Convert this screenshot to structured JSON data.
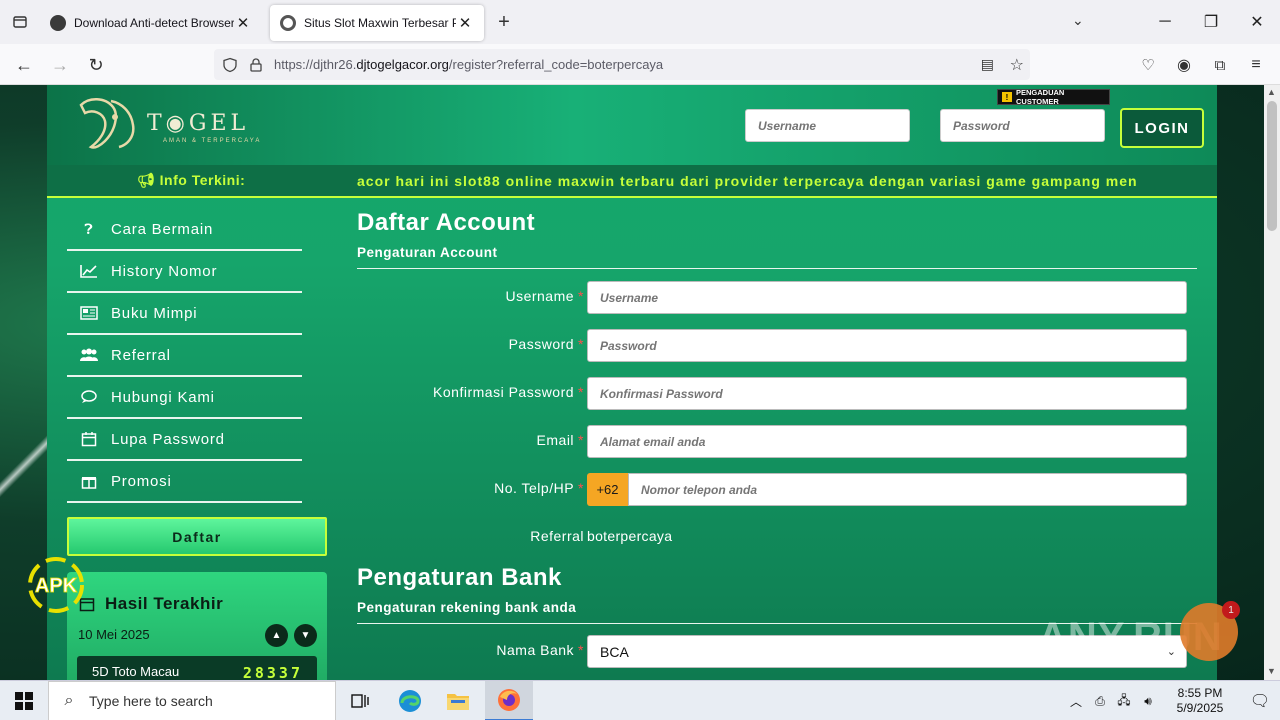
{
  "browser": {
    "tabs": [
      {
        "title": "Download Anti-detect Browser",
        "active": false
      },
      {
        "title": "Situs Slot Maxwin Terbesar Palin",
        "active": true
      }
    ],
    "url_prefix": "https://djthr26.",
    "url_domain": "djtogelgacor.org",
    "url_path": "/register?referral_code=boterpercaya"
  },
  "site": {
    "logo_text": "T◉GEL",
    "logo_tagline": "AMAN & TERPERCAYA",
    "header": {
      "username_placeholder": "Username",
      "password_placeholder": "Password",
      "login_label": "LOGIN",
      "complaint_label": "PENGADUAN CUSTOMER"
    },
    "ticker": {
      "label": "Info Terkini:",
      "message": "acor hari ini slot88 online maxwin terbaru dari provider terpercaya dengan variasi game gampang men"
    },
    "sidebar": {
      "items": [
        {
          "label": "Cara Bermain",
          "icon": "question-circle-icon"
        },
        {
          "label": "History Nomor",
          "icon": "line-chart-icon"
        },
        {
          "label": "Buku Mimpi",
          "icon": "newspaper-icon"
        },
        {
          "label": "Referral",
          "icon": "users-icon"
        },
        {
          "label": "Hubungi Kami",
          "icon": "chat-icon"
        },
        {
          "label": "Lupa Password",
          "icon": "calendar-icon"
        },
        {
          "label": "Promosi",
          "icon": "gift-icon"
        }
      ],
      "daftar_label": "Daftar"
    },
    "hasil": {
      "title": "Hasil Terakhir",
      "date": "10 Mei 2025",
      "rows": [
        {
          "name": "5D Toto Macau",
          "value": "28337"
        }
      ]
    },
    "form": {
      "title": "Daftar Account",
      "subtitle": "Pengaturan Account",
      "fields": {
        "username": {
          "label": "Username",
          "placeholder": "Username"
        },
        "password": {
          "label": "Password",
          "placeholder": "Password"
        },
        "confirm": {
          "label": "Konfirmasi Password",
          "placeholder": "Konfirmasi Password"
        },
        "email": {
          "label": "Email",
          "placeholder": "Alamat email anda"
        },
        "phone": {
          "label": "No. Telp/HP",
          "prefix": "+62",
          "placeholder": "Nomor telepon anda"
        },
        "referral": {
          "label": "Referral",
          "value": "boterpercaya"
        }
      },
      "bank_title": "Pengaturan Bank",
      "bank_subtitle": "Pengaturan rekening bank anda",
      "bank_name": {
        "label": "Nama Bank",
        "value": "BCA"
      },
      "required_mark": "*"
    },
    "chat_badge": "1",
    "watermark": "ANY.RUN",
    "apk_label": "APK"
  },
  "taskbar": {
    "search_placeholder": "Type here to search",
    "time": "8:55 PM",
    "date": "5/9/2025"
  },
  "colors": {
    "accent": "#c6ff3a",
    "site_green": "#16a56b",
    "required": "#ff4d4d"
  }
}
